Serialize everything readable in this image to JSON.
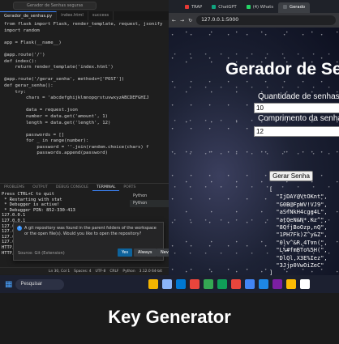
{
  "vscode": {
    "title": "Gerador de Senhas seguras",
    "tabs": [
      {
        "label": "Gerador_de_senhas.py"
      },
      {
        "label": "index.html"
      },
      {
        "label": "success"
      }
    ],
    "code": [
      "from flask import Flask, render_template, request, jsonify",
      "import random",
      "",
      "app = Flask(__name__)",
      "",
      "@app.route('/')",
      "def index():",
      "    return render_template('index.html')",
      "",
      "@app.route('/gerar_senha', methods=['POST'])",
      "def gerar_senha():",
      "    try:",
      "        chars = 'abcdefghijklmnopqrstuvwxyzABCDEFGHIJ",
      "",
      "        data = request.json",
      "        number = data.get('amount', 1)",
      "        length = data.get('length', 12)",
      "",
      "        passwords = []",
      "        for _ in range(number):",
      "            password = ''.join(random.choice(chars) f",
      "            passwords.append(password)"
    ],
    "panel_tabs": [
      "PROBLEMS",
      "OUTPUT",
      "DEBUG CONSOLE",
      "TERMINAL",
      "PORTS"
    ],
    "terminal_lines": [
      "Press CTRL+C to quit",
      " * Restarting with stat",
      " * Debugger is active!",
      " * Debugger PIN: 852-330-413",
      "127.0.0.1",
      "127.0.0.1",
      "127.0.0.1",
      "127.0.0.1",
      "127.0.0.1",
      "127.0.0.1",
      "HTTP/",
      "HTTP/"
    ],
    "terminal_list": [
      "Python",
      "Python"
    ],
    "notification": {
      "message": "A git repository was found in the parent folders of the workspace or the open file(s). Would you like to open the repository?",
      "source": "Source: Git (Extension)",
      "yes": "Yes",
      "always": "Always",
      "never": "Never"
    },
    "status": [
      "Ln 30, Col 1",
      "Spaces: 4",
      "UTF-8",
      "CRLF",
      "Python",
      "3.12.0 64-bit"
    ]
  },
  "browser": {
    "tabs": [
      {
        "label": "TRAP",
        "color": "#e53935"
      },
      {
        "label": "ChatGPT",
        "color": "#10a37f"
      },
      {
        "label": "(4) Whats",
        "color": "#25d366"
      },
      {
        "label": "Gerado",
        "color": "#5f6368"
      }
    ],
    "url": "127.0.0.1:5000",
    "page": {
      "title": "Gerador de Senh",
      "amount_label": "Quantidade de senhas",
      "amount_value": "10",
      "length_label": "Comprimento da senha",
      "length_value": "12",
      "button": "Gerar Senha",
      "result": "[\n  \"IjDAY@VtOKnt\",\n  \"G0B@FpWV!VJ9\",\n  \"aSfNkH4cgg4L\",\n  \"atQeN&N*.Kz^\",\n  \"8QfjBoOzp,nQ\",\n  \"1PH7Fk)Z^y&Z\",\n  \"0lv^&R,4Tvn(\",\n  \"L%#fmBTo%5H(\",\n  \"DlQl,X3E%Iez\",\n  \"3Jjp0VwOiZeC\"\n]"
    }
  },
  "taskbar": {
    "search": "Pesquisar",
    "icons": [
      "#f4b400",
      "#8ab4f8",
      "#0078d4",
      "#e8453c",
      "#34a853",
      "#0f9d58",
      "#e8453c",
      "#4285f4",
      "#1e88e5",
      "#7b1fa2",
      "#fbbc04",
      "#ffffff"
    ]
  },
  "caption": "Key Generator"
}
